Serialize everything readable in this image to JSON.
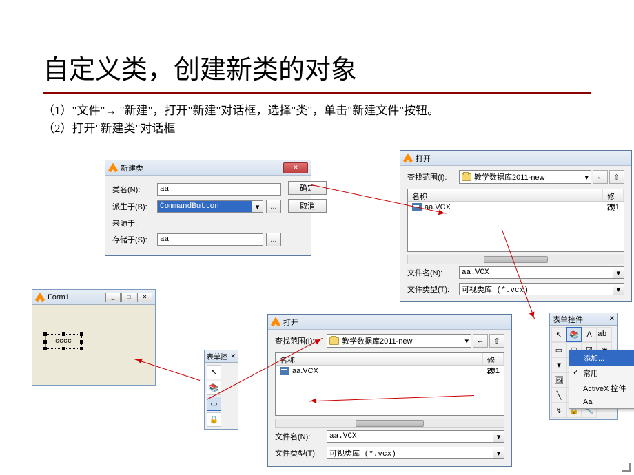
{
  "title": "自定义类，创建新类的对象",
  "step1": "（1）\"文件\"→ \"新建\"，打开\"新建\"对话框，选择\"类\"，单击\"新建文件\"按钮。",
  "step2": "（2）打开\"新建类\"对话框",
  "newclass": {
    "window_title": "新建类",
    "lbl_name": "类名(N):",
    "val_name": "aa",
    "lbl_base": "派生于(B):",
    "val_base": "CommandButton",
    "lbl_from": "来源于:",
    "lbl_store": "存储于(S):",
    "val_store": "aa",
    "btn_ok": "确定",
    "btn_cancel": "取消",
    "btn_browse": "..."
  },
  "open1": {
    "window_title": "打开",
    "lbl_lookin": "查找范围(I):",
    "folder": "教学数据库2011-new",
    "col_name": "名称",
    "col_mod": "修改",
    "file_name": "aa.VCX",
    "file_date": "201",
    "lbl_filename": "文件名(N):",
    "val_filename": "aa.VCX",
    "lbl_filetype": "文件类型(T):",
    "val_filetype": "可视类库 (*.vcx)"
  },
  "open2": {
    "window_title": "打开",
    "lbl_lookin": "查找范围(I):",
    "folder": "教学数据库2011-new",
    "col_name": "名称",
    "col_mod": "修改",
    "file_name": "aa.VCX",
    "file_date": "201",
    "lbl_filename": "文件名(N):",
    "val_filename": "aa.VCX",
    "lbl_filetype": "文件类型(T):",
    "val_filetype": "可视类库 (*.vcx)"
  },
  "form1": {
    "title": "Form1",
    "btn_label": "cccc"
  },
  "toolbox_small": {
    "title": "表单控"
  },
  "toolbox_big": {
    "title": "表单控件",
    "menu_add": "添加...",
    "menu_common": "常用",
    "menu_activex": "ActiveX 控件",
    "menu_aa": "Aa"
  }
}
